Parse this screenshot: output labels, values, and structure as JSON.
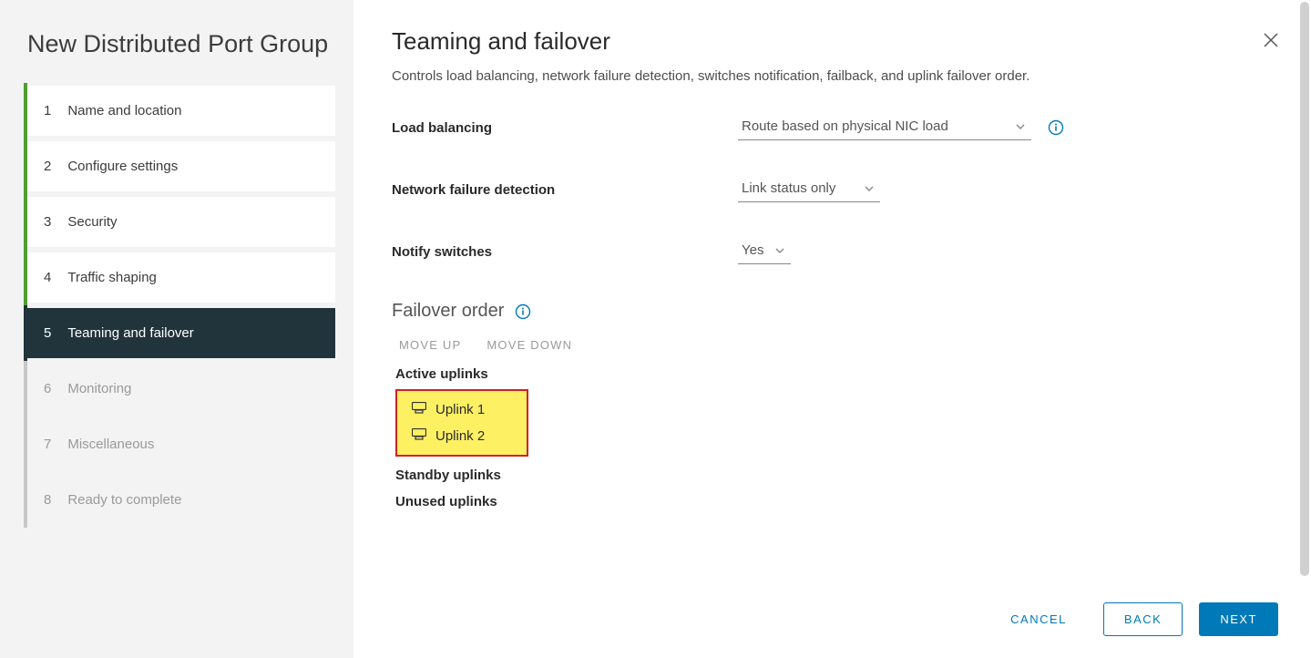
{
  "wizard_title": "New Distributed Port Group",
  "steps": [
    {
      "num": "1",
      "label": "Name and location",
      "state": "completed"
    },
    {
      "num": "2",
      "label": "Configure settings",
      "state": "completed"
    },
    {
      "num": "3",
      "label": "Security",
      "state": "completed"
    },
    {
      "num": "4",
      "label": "Traffic shaping",
      "state": "completed"
    },
    {
      "num": "5",
      "label": "Teaming and failover",
      "state": "current"
    },
    {
      "num": "6",
      "label": "Monitoring",
      "state": "future"
    },
    {
      "num": "7",
      "label": "Miscellaneous",
      "state": "future"
    },
    {
      "num": "8",
      "label": "Ready to complete",
      "state": "future"
    }
  ],
  "page": {
    "heading": "Teaming and failover",
    "description": "Controls load balancing, network failure detection, switches notification, failback, and uplink failover order."
  },
  "settings": {
    "load_balancing": {
      "label": "Load balancing",
      "value": "Route based on physical NIC load"
    },
    "network_failure_detection": {
      "label": "Network failure detection",
      "value": "Link status only"
    },
    "notify_switches": {
      "label": "Notify switches",
      "value": "Yes"
    }
  },
  "failover": {
    "section_label": "Failover order",
    "move_up": "MOVE UP",
    "move_down": "MOVE DOWN",
    "groups": {
      "active": {
        "label": "Active uplinks",
        "items": [
          "Uplink 1",
          "Uplink 2"
        ]
      },
      "standby": {
        "label": "Standby uplinks",
        "items": []
      },
      "unused": {
        "label": "Unused uplinks",
        "items": []
      }
    }
  },
  "buttons": {
    "cancel": "CANCEL",
    "back": "BACK",
    "next": "NEXT"
  }
}
